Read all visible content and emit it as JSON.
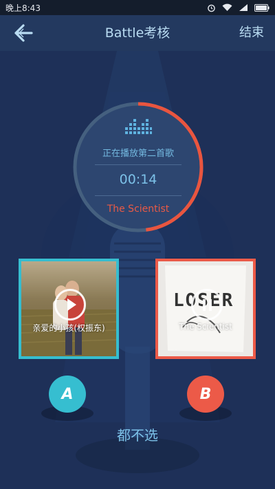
{
  "status_bar": {
    "time": "晚上8:43"
  },
  "header": {
    "title": "Battle考核",
    "end_label": "结束"
  },
  "player": {
    "now_playing": "正在播放第二首歌",
    "timer": "00:14",
    "current_song": "The Scientist",
    "progress": 0.48
  },
  "cards": [
    {
      "caption": "亲爱的小孩(权振东)"
    },
    {
      "caption": "The Scientist",
      "cover_text": "LOSER"
    }
  ],
  "choices": {
    "a_label": "A",
    "b_label": "B",
    "none_label": "都不选"
  },
  "colors": {
    "background": "#1e3058",
    "header": "#23395f",
    "accent_a": "#36bed0",
    "accent_b": "#ec5a48",
    "text_light": "#7cc1e8"
  },
  "icons": {
    "back": "back-arrow-icon",
    "equalizer": "equalizer-icon",
    "play": "play-icon",
    "pause": "pause-icon"
  }
}
